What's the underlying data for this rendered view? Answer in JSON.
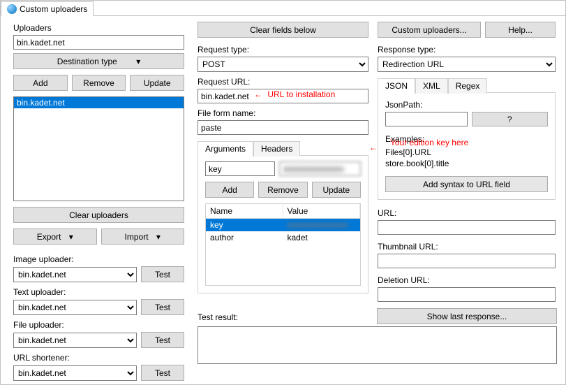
{
  "app": {
    "tab_title": "Custom uploaders"
  },
  "left": {
    "uploaders_label": "Uploaders",
    "uploader_name_value": "bin.kadet.net",
    "destination_type_label": "Destination type",
    "add": "Add",
    "remove": "Remove",
    "update": "Update",
    "list": [
      "bin.kadet.net"
    ],
    "clear_uploaders": "Clear uploaders",
    "export": "Export",
    "import": "Import",
    "image_uploader_label": "Image uploader:",
    "text_uploader_label": "Text uploader:",
    "file_uploader_label": "File uploader:",
    "url_shortener_label": "URL shortener:",
    "combo_value": "bin.kadet.net",
    "test": "Test"
  },
  "mid": {
    "clear_fields": "Clear fields below",
    "request_type_label": "Request type:",
    "request_type_value": "POST",
    "request_url_label": "Request URL:",
    "request_url_value": "bin.kadet.net",
    "file_form_label": "File form name:",
    "file_form_value": "paste",
    "tab_arguments": "Arguments",
    "tab_headers": "Headers",
    "arg_name_value": "key",
    "arg_value_value": "■■■■■■■■■■■■",
    "add": "Add",
    "remove": "Remove",
    "update": "Update",
    "table": {
      "headers": [
        "Name",
        "Value"
      ],
      "rows": [
        {
          "name": "key",
          "value": "■■■■■■■■■■■■",
          "blur": true
        },
        {
          "name": "author",
          "value": "kadet"
        }
      ]
    },
    "test_result_label": "Test result:"
  },
  "right": {
    "custom_uploaders_btn": "Custom uploaders...",
    "help_btn": "Help...",
    "response_type_label": "Response type:",
    "response_type_value": "Redirection URL",
    "tab_json": "JSON",
    "tab_xml": "XML",
    "tab_regex": "Regex",
    "jsonpath_label": "JsonPath:",
    "jsonpath_value": "",
    "q": "?",
    "examples_label": "Examples:",
    "example1": "Files[0].URL",
    "example2": "store.book[0].title",
    "add_syntax": "Add syntax to URL field",
    "url_label": "URL:",
    "thumb_label": "Thumbnail URL:",
    "del_label": "Deletion URL:",
    "show_last": "Show last response..."
  },
  "annotations": {
    "url_hint": "URL to installation",
    "key_hint": "Your edition key here"
  }
}
